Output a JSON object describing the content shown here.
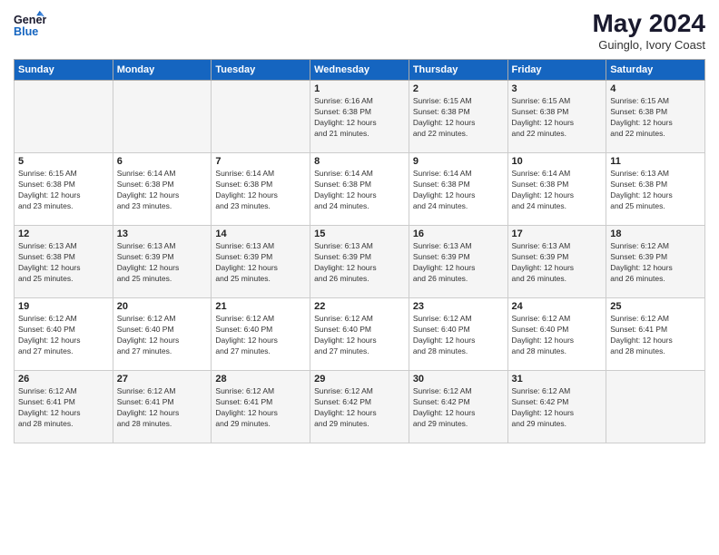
{
  "header": {
    "logo_line1": "General",
    "logo_line2": "Blue",
    "month_year": "May 2024",
    "location": "Guinglo, Ivory Coast"
  },
  "days_of_week": [
    "Sunday",
    "Monday",
    "Tuesday",
    "Wednesday",
    "Thursday",
    "Friday",
    "Saturday"
  ],
  "weeks": [
    [
      {
        "day": "",
        "info": ""
      },
      {
        "day": "",
        "info": ""
      },
      {
        "day": "",
        "info": ""
      },
      {
        "day": "1",
        "info": "Sunrise: 6:16 AM\nSunset: 6:38 PM\nDaylight: 12 hours\nand 21 minutes."
      },
      {
        "day": "2",
        "info": "Sunrise: 6:15 AM\nSunset: 6:38 PM\nDaylight: 12 hours\nand 22 minutes."
      },
      {
        "day": "3",
        "info": "Sunrise: 6:15 AM\nSunset: 6:38 PM\nDaylight: 12 hours\nand 22 minutes."
      },
      {
        "day": "4",
        "info": "Sunrise: 6:15 AM\nSunset: 6:38 PM\nDaylight: 12 hours\nand 22 minutes."
      }
    ],
    [
      {
        "day": "5",
        "info": "Sunrise: 6:15 AM\nSunset: 6:38 PM\nDaylight: 12 hours\nand 23 minutes."
      },
      {
        "day": "6",
        "info": "Sunrise: 6:14 AM\nSunset: 6:38 PM\nDaylight: 12 hours\nand 23 minutes."
      },
      {
        "day": "7",
        "info": "Sunrise: 6:14 AM\nSunset: 6:38 PM\nDaylight: 12 hours\nand 23 minutes."
      },
      {
        "day": "8",
        "info": "Sunrise: 6:14 AM\nSunset: 6:38 PM\nDaylight: 12 hours\nand 24 minutes."
      },
      {
        "day": "9",
        "info": "Sunrise: 6:14 AM\nSunset: 6:38 PM\nDaylight: 12 hours\nand 24 minutes."
      },
      {
        "day": "10",
        "info": "Sunrise: 6:14 AM\nSunset: 6:38 PM\nDaylight: 12 hours\nand 24 minutes."
      },
      {
        "day": "11",
        "info": "Sunrise: 6:13 AM\nSunset: 6:38 PM\nDaylight: 12 hours\nand 25 minutes."
      }
    ],
    [
      {
        "day": "12",
        "info": "Sunrise: 6:13 AM\nSunset: 6:38 PM\nDaylight: 12 hours\nand 25 minutes."
      },
      {
        "day": "13",
        "info": "Sunrise: 6:13 AM\nSunset: 6:39 PM\nDaylight: 12 hours\nand 25 minutes."
      },
      {
        "day": "14",
        "info": "Sunrise: 6:13 AM\nSunset: 6:39 PM\nDaylight: 12 hours\nand 25 minutes."
      },
      {
        "day": "15",
        "info": "Sunrise: 6:13 AM\nSunset: 6:39 PM\nDaylight: 12 hours\nand 26 minutes."
      },
      {
        "day": "16",
        "info": "Sunrise: 6:13 AM\nSunset: 6:39 PM\nDaylight: 12 hours\nand 26 minutes."
      },
      {
        "day": "17",
        "info": "Sunrise: 6:13 AM\nSunset: 6:39 PM\nDaylight: 12 hours\nand 26 minutes."
      },
      {
        "day": "18",
        "info": "Sunrise: 6:12 AM\nSunset: 6:39 PM\nDaylight: 12 hours\nand 26 minutes."
      }
    ],
    [
      {
        "day": "19",
        "info": "Sunrise: 6:12 AM\nSunset: 6:40 PM\nDaylight: 12 hours\nand 27 minutes."
      },
      {
        "day": "20",
        "info": "Sunrise: 6:12 AM\nSunset: 6:40 PM\nDaylight: 12 hours\nand 27 minutes."
      },
      {
        "day": "21",
        "info": "Sunrise: 6:12 AM\nSunset: 6:40 PM\nDaylight: 12 hours\nand 27 minutes."
      },
      {
        "day": "22",
        "info": "Sunrise: 6:12 AM\nSunset: 6:40 PM\nDaylight: 12 hours\nand 27 minutes."
      },
      {
        "day": "23",
        "info": "Sunrise: 6:12 AM\nSunset: 6:40 PM\nDaylight: 12 hours\nand 28 minutes."
      },
      {
        "day": "24",
        "info": "Sunrise: 6:12 AM\nSunset: 6:40 PM\nDaylight: 12 hours\nand 28 minutes."
      },
      {
        "day": "25",
        "info": "Sunrise: 6:12 AM\nSunset: 6:41 PM\nDaylight: 12 hours\nand 28 minutes."
      }
    ],
    [
      {
        "day": "26",
        "info": "Sunrise: 6:12 AM\nSunset: 6:41 PM\nDaylight: 12 hours\nand 28 minutes."
      },
      {
        "day": "27",
        "info": "Sunrise: 6:12 AM\nSunset: 6:41 PM\nDaylight: 12 hours\nand 28 minutes."
      },
      {
        "day": "28",
        "info": "Sunrise: 6:12 AM\nSunset: 6:41 PM\nDaylight: 12 hours\nand 29 minutes."
      },
      {
        "day": "29",
        "info": "Sunrise: 6:12 AM\nSunset: 6:42 PM\nDaylight: 12 hours\nand 29 minutes."
      },
      {
        "day": "30",
        "info": "Sunrise: 6:12 AM\nSunset: 6:42 PM\nDaylight: 12 hours\nand 29 minutes."
      },
      {
        "day": "31",
        "info": "Sunrise: 6:12 AM\nSunset: 6:42 PM\nDaylight: 12 hours\nand 29 minutes."
      },
      {
        "day": "",
        "info": ""
      }
    ]
  ]
}
